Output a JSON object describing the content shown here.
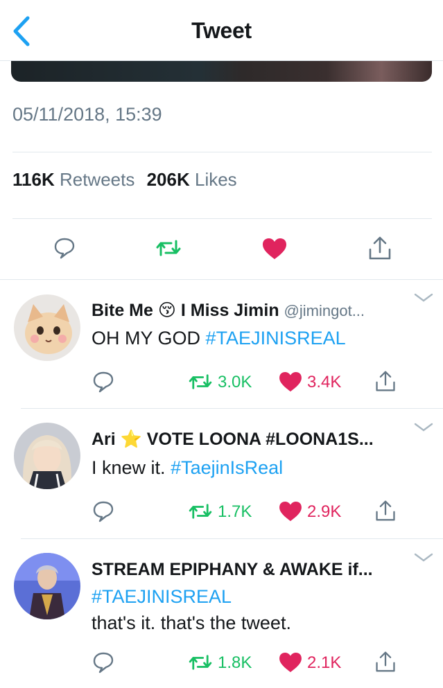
{
  "nav": {
    "title": "Tweet"
  },
  "tweet": {
    "timestamp": "05/11/2018, 15:39",
    "retweets_count": "116K",
    "retweets_label": "Retweets",
    "likes_count": "206K",
    "likes_label": "Likes"
  },
  "replies": [
    {
      "name_a": "Bite Me",
      "emoji": "😚",
      "name_b": "I Miss Jimin",
      "handle": "@jimingot...",
      "text_plain": "OH MY GOD",
      "text_hash": "#TAEJINISREAL",
      "retweets": "3.0K",
      "likes": "3.4K"
    },
    {
      "name_a": "Ari",
      "emoji": "⭐",
      "name_b": "VOTE LOONA #LOONA1S...",
      "text_plain": "I knew it.",
      "text_hash": "#TaejinIsReal",
      "retweets": "1.7K",
      "likes": "2.9K"
    },
    {
      "name": "STREAM EPIPHANY & AWAKE if...",
      "text_hash": "#TAEJINISREAL",
      "text_plain": "that's it. that's the tweet.",
      "retweets": "1.8K",
      "likes": "2.1K"
    }
  ],
  "colors": {
    "accent": "#1da1f2",
    "retweet": "#17bf63",
    "like": "#e0245e",
    "muted": "#657786"
  },
  "icons": [
    "back-chevron-icon",
    "reply-icon",
    "retweet-icon",
    "heart-icon",
    "share-icon",
    "chevron-down-icon"
  ]
}
